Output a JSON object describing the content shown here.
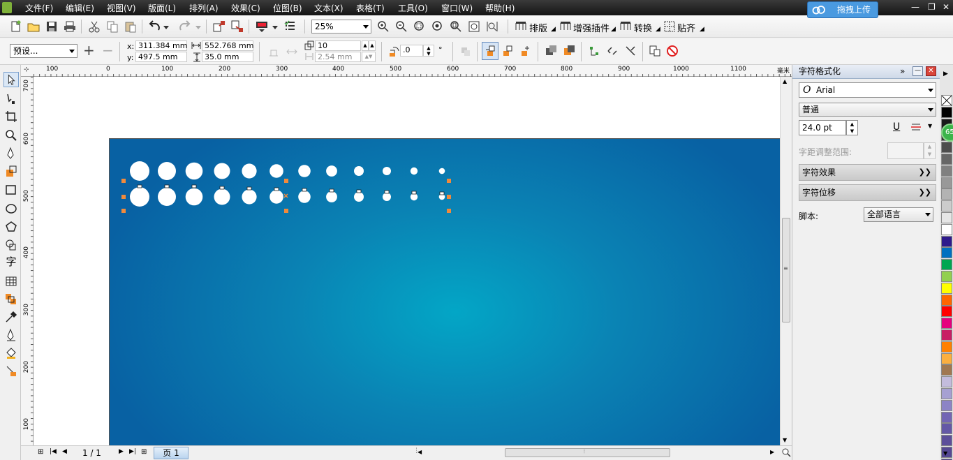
{
  "menu": [
    "文件(F)",
    "编辑(E)",
    "视图(V)",
    "版面(L)",
    "排列(A)",
    "效果(C)",
    "位图(B)",
    "文本(X)",
    "表格(T)",
    "工具(O)",
    "窗口(W)",
    "帮助(H)"
  ],
  "upload_button": "拖拽上传",
  "toolbar1": {
    "zoom": "25%",
    "layout_label": "排版",
    "plugins_label": "增强插件",
    "convert_label": "转换",
    "snap_label": "贴齐"
  },
  "toolbar2": {
    "preset": "预设...",
    "x_label": "x:",
    "x": "311.384 mm",
    "y_label": "y:",
    "y": "497.5 mm",
    "width": "552.768 mm",
    "height": "35.0 mm",
    "step_count": "10",
    "spacing": "2.54 mm",
    "angle": ".0",
    "angle_unit": "°"
  },
  "hruler_labels": [
    "100",
    "0",
    "100",
    "200",
    "300",
    "400",
    "500",
    "600",
    "700",
    "800",
    "900",
    "1000",
    "1100"
  ],
  "hruler_unit": "毫米",
  "vruler_labels": [
    "700",
    "600",
    "500",
    "400",
    "300",
    "200",
    "100"
  ],
  "docker": {
    "title": "字符格式化",
    "font": "Arial",
    "style": "普通",
    "size": "24.0 pt",
    "tracking_label": "字距调整范围:",
    "char_effects": "字符效果",
    "char_displacement": "字符位移",
    "script_label": "脚本:",
    "script_value": "全部语言"
  },
  "status": {
    "page_count": "1 / 1",
    "page_tab": "页 1"
  },
  "palette_badge": "65",
  "palette_colors": [
    "#ffffff",
    "#000000",
    "#1a1a1a",
    "#333333",
    "#4d4d4d",
    "#666666",
    "#808080",
    "#999999",
    "#b3b3b3",
    "#cccccc",
    "#e6e6e6",
    "#ffffff",
    "#2e1a8c",
    "#0070c0",
    "#00a651",
    "#92d050",
    "#ffff00",
    "#ff6600",
    "#ff0000",
    "#e6007e",
    "#c81e64",
    "#ff8000",
    "#fbaf3f",
    "#a07850",
    "#c3bcdc",
    "#a6a0d2",
    "#8c84c6",
    "#7366b4",
    "#6458a6",
    "#5c4e9a",
    "#554893",
    "#4f4389"
  ]
}
